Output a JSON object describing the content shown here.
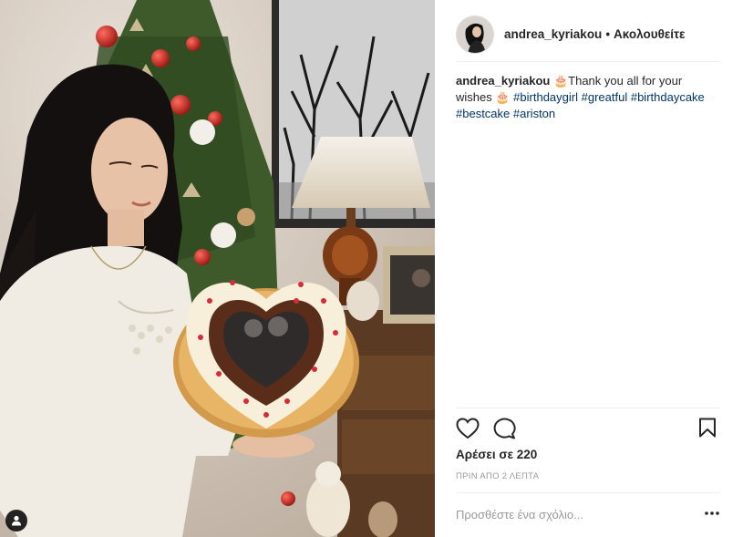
{
  "post": {
    "username": "andrea_kyriakou",
    "separator": "•",
    "follow_label": "Ακολουθείτε",
    "caption": {
      "username": "andrea_kyriakou",
      "emoji_1": "🎂",
      "text_1": "Thank you all for your wishes ",
      "emoji_2": "🎂",
      "hashtags": [
        "#birthdaygirl",
        "#greatful",
        "#birthdaycake",
        "#bestcake",
        "#ariston"
      ]
    },
    "likes": "Αρέσει σε 220",
    "time_ago": "ΠΡΙΝ ΑΠΟ 2 ΛΕΠΤΑ",
    "comment_placeholder": "Προσθέστε ένα σχόλιο...",
    "icons": {
      "like": "heart-icon",
      "comment": "speech-bubble-icon",
      "save": "bookmark-icon",
      "more": "ellipsis-icon",
      "user_tags": "user-silhouette-icon"
    }
  },
  "colors": {
    "hashtag": "#003569",
    "text": "#262626",
    "muted": "#999999",
    "divider": "#efefef"
  }
}
